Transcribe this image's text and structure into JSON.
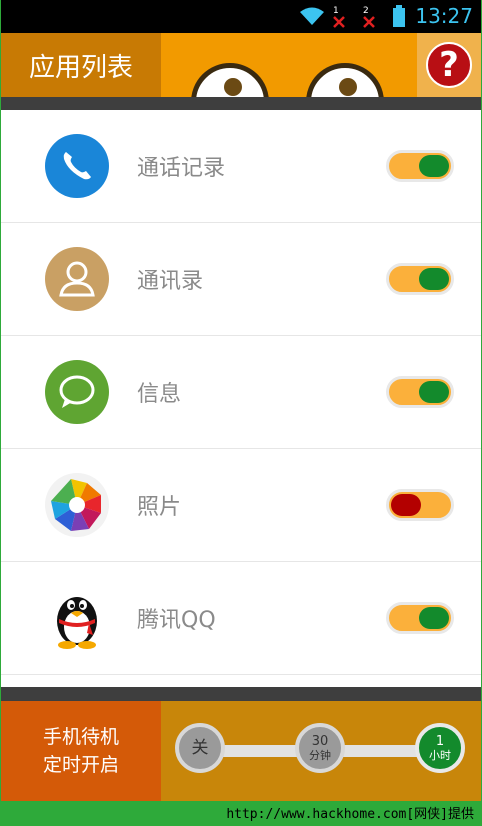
{
  "status_bar": {
    "time": "13:27",
    "sim1": "1",
    "sim2": "2"
  },
  "header": {
    "title": "应用列表",
    "help_label": "?"
  },
  "apps": [
    {
      "name": "通话记录",
      "icon": "phone-icon",
      "enabled": true
    },
    {
      "name": "通讯录",
      "icon": "contacts-icon",
      "enabled": true
    },
    {
      "name": "信息",
      "icon": "message-icon",
      "enabled": true
    },
    {
      "name": "照片",
      "icon": "photos-icon",
      "enabled": false
    },
    {
      "name": "腾讯QQ",
      "icon": "qq-penguin-icon",
      "enabled": true
    }
  ],
  "timer": {
    "label_line1": "手机待机",
    "label_line2": "定时开启",
    "options": [
      {
        "line1": "关",
        "line2": "",
        "selected": false
      },
      {
        "line1": "30",
        "line2": "分钟",
        "selected": false
      },
      {
        "line1": "1",
        "line2": "小时",
        "selected": true
      }
    ]
  },
  "watermark": "http://www.hackhome.com[网侠]提供",
  "colors": {
    "toggle_on": "#138a2c",
    "toggle_off": "#b30000",
    "toggle_track": "#fbb03b",
    "header": "#f29a00",
    "help": "#b80f14"
  }
}
